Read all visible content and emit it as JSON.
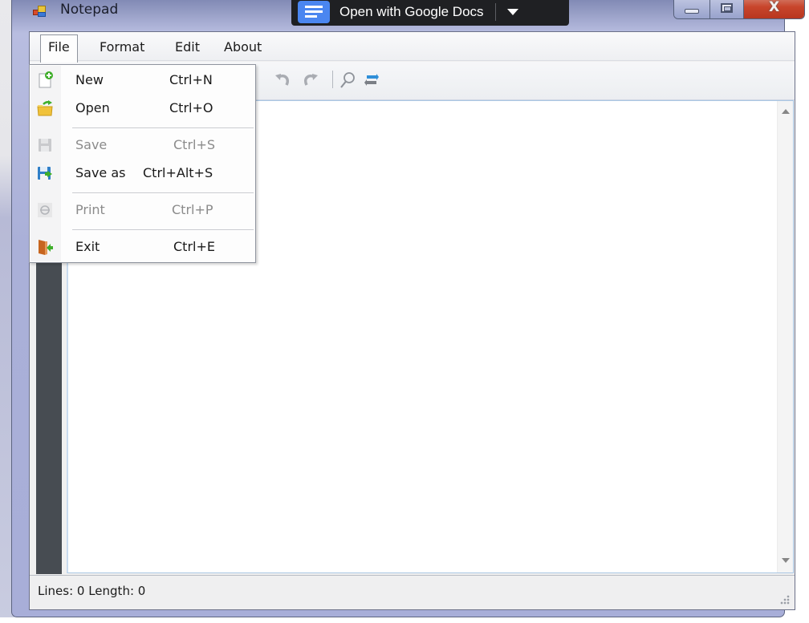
{
  "window": {
    "title": "Notepad",
    "icon": "notepad-app-icon",
    "controls": {
      "minimize": "minimize-icon",
      "maximize": "maximize-icon",
      "close_label": "X"
    }
  },
  "overlay": {
    "label": "Open with Google Docs",
    "icon": "google-docs-icon",
    "dropdown_icon": "caret-down-icon"
  },
  "menubar": {
    "items": [
      {
        "label": "File",
        "active": true
      },
      {
        "label": "Format"
      },
      {
        "label": "Edit"
      },
      {
        "label": "About"
      }
    ]
  },
  "toolbar": {
    "buttons": [
      {
        "icon": "undo-icon",
        "enabled": false
      },
      {
        "icon": "redo-icon",
        "enabled": false
      },
      {
        "icon": "search-icon",
        "enabled": true
      },
      {
        "icon": "replace-icon",
        "enabled": true
      }
    ]
  },
  "file_menu": {
    "items": [
      {
        "label": "New",
        "shortcut": "Ctrl+N",
        "icon": "new-file-icon",
        "enabled": true
      },
      {
        "label": "Open",
        "shortcut": "Ctrl+O",
        "icon": "open-folder-icon",
        "enabled": true
      },
      {
        "label": "Save",
        "shortcut": "Ctrl+S",
        "icon": "save-icon",
        "enabled": false
      },
      {
        "label": "Save as",
        "shortcut": "Ctrl+Alt+S",
        "icon": "save-as-icon",
        "enabled": true
      },
      {
        "label": "Print",
        "shortcut": "Ctrl+P",
        "icon": "print-icon",
        "enabled": false
      },
      {
        "label": "Exit",
        "shortcut": "Ctrl+E",
        "icon": "exit-icon",
        "enabled": true
      }
    ]
  },
  "editor": {
    "content": "",
    "placeholder": ""
  },
  "statusbar": {
    "text": "Lines: 0 Length: 0"
  },
  "colors": {
    "gutter": "#474c52",
    "accent_blue": "#4a86f0",
    "close_red": "#c8452c"
  }
}
